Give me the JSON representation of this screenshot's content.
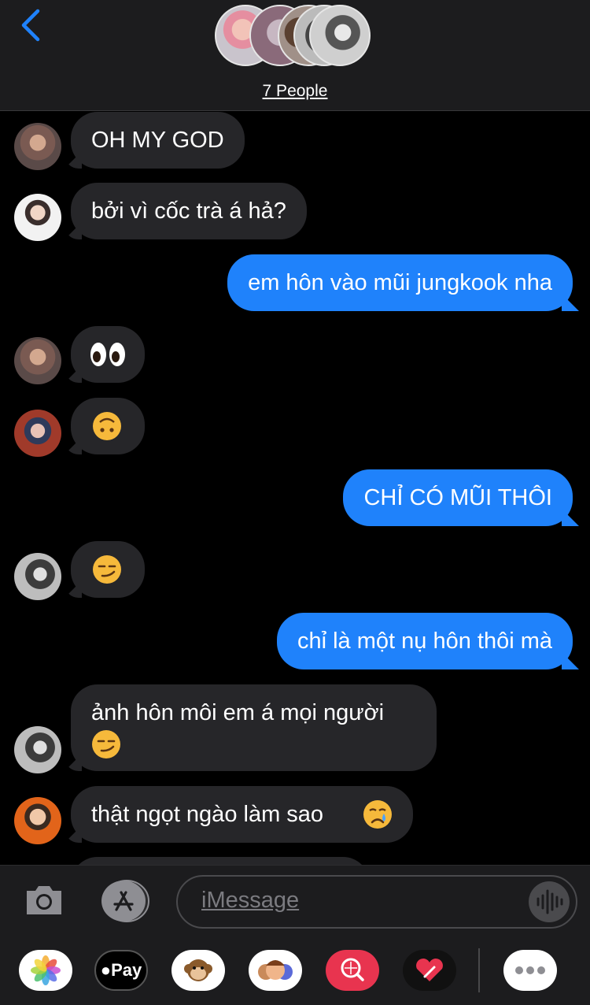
{
  "header": {
    "back_icon": "chevron-left-icon",
    "group_title": "7 People"
  },
  "messages": [
    {
      "direction": "incoming",
      "text": "OH MY GOD"
    },
    {
      "direction": "incoming",
      "text": "bởi vì cốc trà á hả?"
    },
    {
      "direction": "outgoing",
      "text": "em hôn vào mũi jungkook nha"
    },
    {
      "direction": "incoming",
      "text": "",
      "emoji": "eyes-emoji"
    },
    {
      "direction": "incoming",
      "text": "",
      "emoji": "upside-down-face-emoji"
    },
    {
      "direction": "outgoing",
      "text": "CHỈ CÓ MŨI THÔI"
    },
    {
      "direction": "incoming",
      "text": "",
      "emoji": "smirking-face-emoji"
    },
    {
      "direction": "outgoing",
      "text": "chỉ là một nụ hôn thôi mà"
    },
    {
      "direction": "incoming",
      "text": "ảnh hôn môi em á mọi người",
      "emoji": "smirking-face-emoji"
    },
    {
      "direction": "incoming",
      "text": "thật ngọt ngào làm sao",
      "emoji": "crying-face-emoji"
    }
  ],
  "input": {
    "placeholder": "iMessage",
    "camera_icon": "camera-icon",
    "appstore_icon": "app-store-icon",
    "audio_icon": "audio-waveform-icon"
  },
  "apps": {
    "photos": "photos-icon",
    "applepay_label": "Pay",
    "animoji": "monkey-animoji-icon",
    "memoji": "memoji-icon",
    "search": "image-search-icon",
    "digital_touch": "digital-touch-icon",
    "more": "more-icon"
  },
  "colors": {
    "outgoing_bubble": "#1f82fb",
    "incoming_bubble": "#262629",
    "accent": "#1f82fb"
  }
}
